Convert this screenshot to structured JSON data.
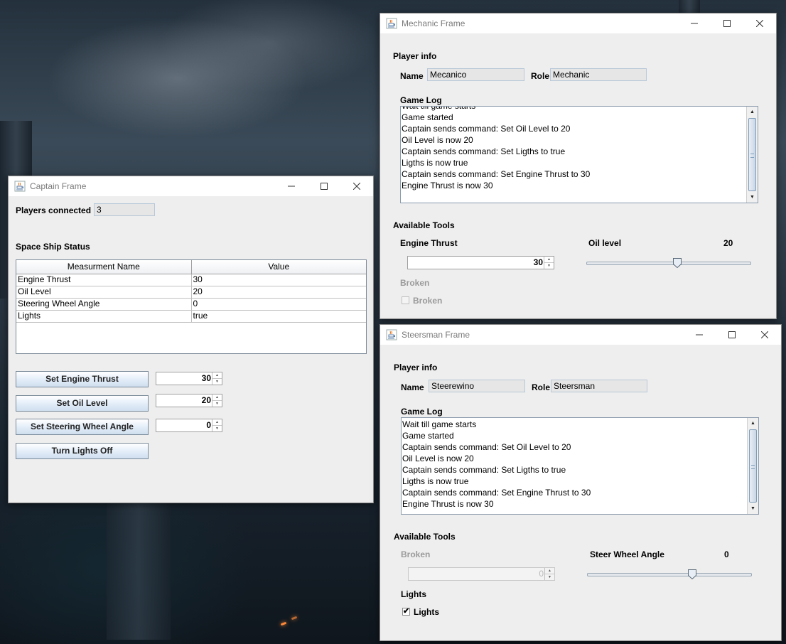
{
  "captain": {
    "title": "Captain Frame",
    "players_label": "Players connected",
    "players_value": "3",
    "status_heading": "Space Ship Status",
    "table": {
      "headers": [
        "Measurment Name",
        "Value"
      ],
      "rows": [
        [
          "Engine Thrust",
          "30"
        ],
        [
          "Oil Level",
          "20"
        ],
        [
          "Steering Wheel Angle",
          "0"
        ],
        [
          "Lights",
          "true"
        ]
      ]
    },
    "buttons": {
      "engine": "Set Engine Thrust",
      "oil": "Set Oil Level",
      "steering": "Set Steering Wheel Angle",
      "lights": "Turn Lights Off"
    },
    "spinners": {
      "engine": "30",
      "oil": "20",
      "steering": "0"
    }
  },
  "mechanic": {
    "title": "Mechanic Frame",
    "player_info": "Player info",
    "name_label": "Name",
    "name_value": "Mecanico",
    "role_label": "Role",
    "role_value": "Mechanic",
    "log_label": "Game Log",
    "log": [
      "Wait till game starts",
      "Game started",
      "Captain sends command: Set Oil Level to 20",
      "Oil Level is now 20",
      "Captain sends command: Set Ligths to true",
      "Ligths is now true",
      "Captain sends command: Set Engine Thrust to 30",
      "Engine Thrust is now 30"
    ],
    "tools_label": "Available Tools",
    "engine_label": "Engine Thrust",
    "engine_value": "30",
    "oil_label": "Oil level",
    "oil_value": "20",
    "oil_slider_fraction": 0.55,
    "broken_label": "Broken",
    "broken_checkbox": "Broken",
    "broken_checked": false
  },
  "steersman": {
    "title": "Steersman Frame",
    "player_info": "Player info",
    "name_label": "Name",
    "name_value": "Steerewino",
    "role_label": "Role",
    "role_value": "Steersman",
    "log_label": "Game Log",
    "log": [
      "Wait till game starts",
      "Game started",
      "Captain sends command: Set Oil Level to 20",
      "Oil Level is now 20",
      "Captain sends command: Set Ligths to true",
      "Ligths is now true",
      "Captain sends command: Set Engine Thrust to 30",
      "Engine Thrust is now 30"
    ],
    "tools_label": "Available Tools",
    "broken_label": "Broken",
    "broken_value": "0",
    "steer_label": "Steer Wheel Angle",
    "steer_value": "0",
    "steer_slider_fraction": 0.64,
    "lights_label": "Lights",
    "lights_checkbox": "Lights",
    "lights_checked": true
  },
  "icons": {
    "app": "java-cup-icon",
    "minimize": "minimize-icon",
    "maximize": "maximize-icon",
    "close": "close-icon"
  }
}
